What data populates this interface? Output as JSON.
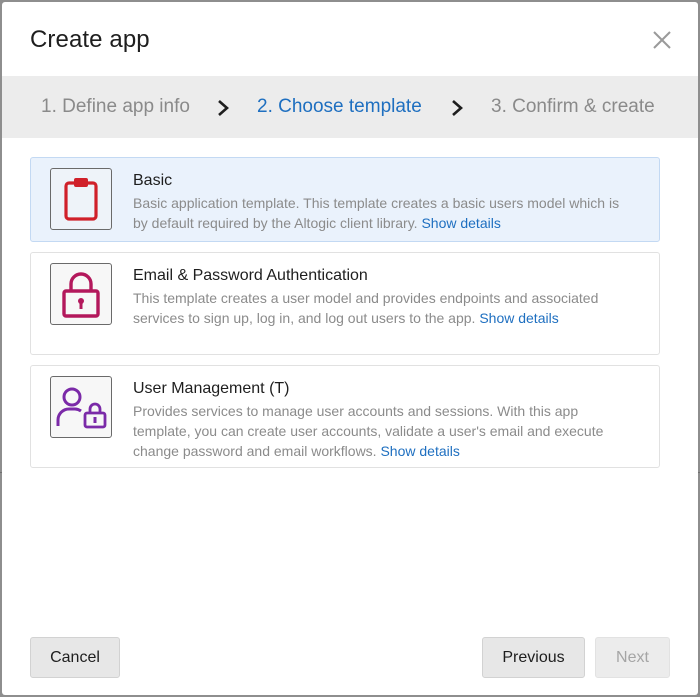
{
  "modal": {
    "title": "Create app",
    "close_icon": "close-icon"
  },
  "steps": [
    {
      "label": "1. Define app info",
      "state": "inactive"
    },
    {
      "label": "2. Choose template",
      "state": "active"
    },
    {
      "label": "3. Confirm & create",
      "state": "inactive"
    }
  ],
  "templates": [
    {
      "title": "Basic",
      "description": "Basic application template. This template creates a basic users model which is by default required by the Altogic client library.",
      "link": "Show details",
      "icon": "clipboard-icon",
      "icon_color": "#d0202a",
      "selected": true
    },
    {
      "title": "Email & Password Authentication",
      "description": "This template creates a user model and provides endpoints and associated services to sign up, log in, and log out users to the app.",
      "link": "Show details",
      "icon": "padlock-icon",
      "icon_color": "#b3185c",
      "selected": false
    },
    {
      "title": "User Management (T)",
      "description": "Provides services to manage user accounts and sessions. With this app template, you can create user accounts, validate a user's email and execute change password and email workflows.",
      "link": "Show details",
      "icon": "user-lock-icon",
      "icon_color": "#7b2aa8",
      "selected": false
    }
  ],
  "footer": {
    "cancel_label": "Cancel",
    "previous_label": "Previous",
    "next_label": "Next",
    "next_disabled": true
  },
  "colors": {
    "accent": "#1e6fc0",
    "selected_card_bg": "#eaf2fc",
    "stepper_bg": "#ececec"
  }
}
